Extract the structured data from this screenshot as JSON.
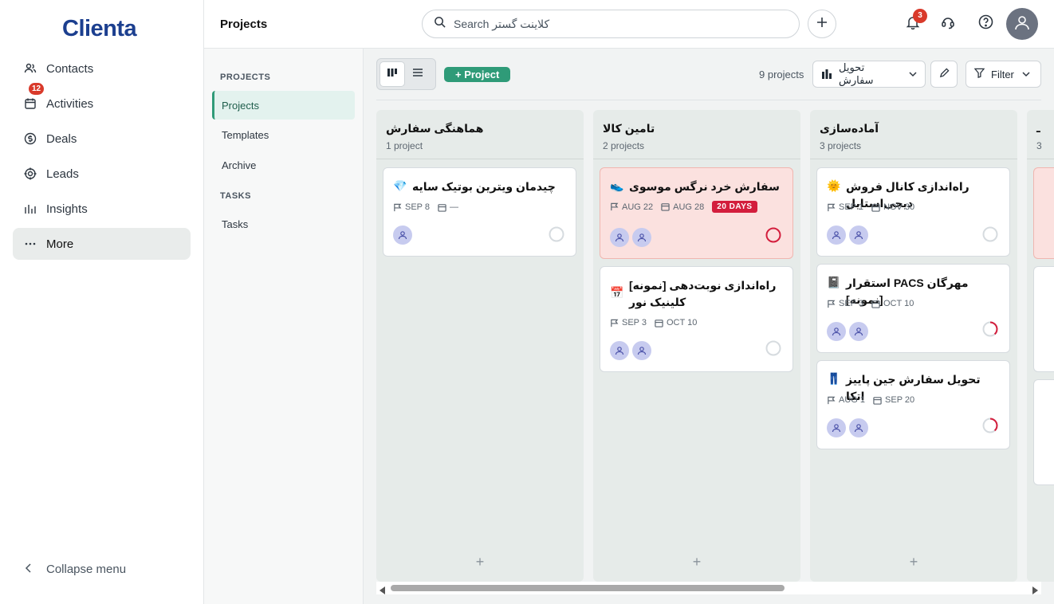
{
  "app": {
    "logo": "Clienta"
  },
  "sidebar": {
    "items": [
      {
        "label": "Contacts",
        "icon": "contacts-icon"
      },
      {
        "label": "Activities",
        "icon": "calendar-icon",
        "badge": "12"
      },
      {
        "label": "Deals",
        "icon": "dollar-icon"
      },
      {
        "label": "Leads",
        "icon": "target-icon"
      },
      {
        "label": "Insights",
        "icon": "bar-chart-icon"
      },
      {
        "label": "More",
        "icon": "more-icon"
      }
    ],
    "collapse_label": "Collapse menu"
  },
  "topbar": {
    "title": "Projects",
    "search_placeholder": "Search کلاینت گستر",
    "notifications_count": "3"
  },
  "subnav": {
    "projects_heading": "PROJECTS",
    "projects_items": [
      "Projects",
      "Templates",
      "Archive"
    ],
    "tasks_heading": "TASKS",
    "tasks_items": [
      "Tasks"
    ]
  },
  "toolbar": {
    "add_project": "+ Project",
    "count": "9 projects",
    "pipeline": "تحویل سفارش",
    "filter": "Filter"
  },
  "columns": [
    {
      "title": "هماهنگی سفارش",
      "count": "1 project",
      "cards": [
        {
          "title": "چیدمان ویترین بوتیک سایه",
          "emoji": "💎",
          "start": "SEP 8",
          "end": "—",
          "status": "empty"
        }
      ]
    },
    {
      "title": "تامین کالا",
      "count": "2 projects",
      "cards": [
        {
          "title": "سفارش خرد نرگس موسوی",
          "emoji": "👟",
          "start": "AUG 22",
          "end": "AUG 28",
          "badge": "20 DAYS",
          "status": "overdue"
        },
        {
          "title": "راه‌اندازی نوبت‌دهی [نمونه] کلینیک نور",
          "emoji": "📅",
          "start": "SEP 3",
          "end": "OCT 10",
          "status": "empty"
        }
      ]
    },
    {
      "title": "آماده‌سازی",
      "count": "3 projects",
      "cards": [
        {
          "title": "راه‌اندازی کانال فروش دیجی‌استایل",
          "emoji": "🌞",
          "start": "SEP 1",
          "end": "NOV 30",
          "status": "empty"
        },
        {
          "title": "مهرگان PACS استقرار [نمونه]",
          "emoji": "📓",
          "start": "SEP 3",
          "end": "OCT 10",
          "status": "partial"
        },
        {
          "title": "تحویل سفارش جین پاییز اتکا",
          "emoji": "👖",
          "start": "AUG 1",
          "end": "SEP 20",
          "status": "partial"
        }
      ]
    },
    {
      "title": "ـ",
      "count": "3",
      "cards": []
    }
  ],
  "colors": {
    "accent": "#2f9b78",
    "danger": "#d31e3d",
    "brand": "#1c3f8f"
  }
}
